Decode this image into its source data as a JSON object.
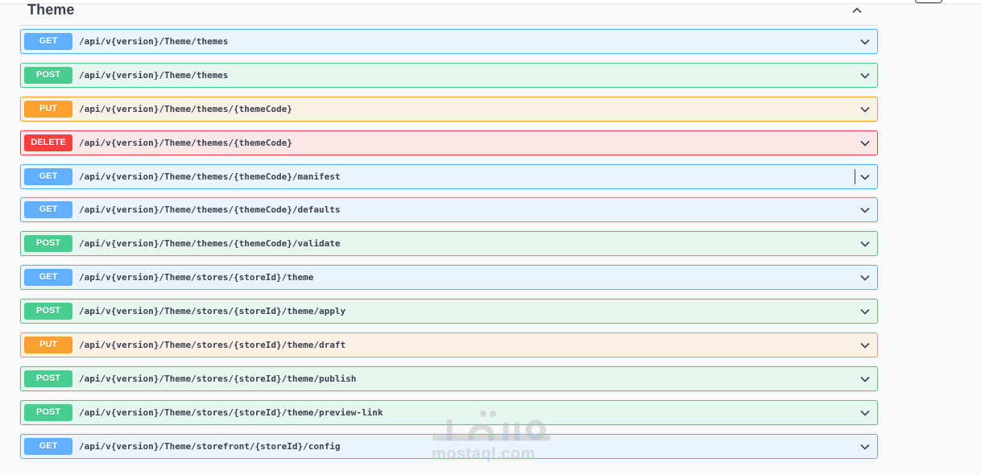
{
  "section": {
    "title": "Theme"
  },
  "operations": [
    {
      "method": "GET",
      "path": "/api/v{version}/Theme/themes"
    },
    {
      "method": "POST",
      "path": "/api/v{version}/Theme/themes"
    },
    {
      "method": "PUT",
      "path": "/api/v{version}/Theme/themes/{themeCode}"
    },
    {
      "method": "DELETE",
      "path": "/api/v{version}/Theme/themes/{themeCode}"
    },
    {
      "method": "GET",
      "path": "/api/v{version}/Theme/themes/{themeCode}/manifest"
    },
    {
      "method": "GET",
      "path": "/api/v{version}/Theme/themes/{themeCode}/defaults"
    },
    {
      "method": "POST",
      "path": "/api/v{version}/Theme/themes/{themeCode}/validate"
    },
    {
      "method": "GET",
      "path": "/api/v{version}/Theme/stores/{storeId}/theme"
    },
    {
      "method": "POST",
      "path": "/api/v{version}/Theme/stores/{storeId}/theme/apply"
    },
    {
      "method": "PUT",
      "path": "/api/v{version}/Theme/stores/{storeId}/theme/draft"
    },
    {
      "method": "POST",
      "path": "/api/v{version}/Theme/stores/{storeId}/theme/publish"
    },
    {
      "method": "POST",
      "path": "/api/v{version}/Theme/stores/{storeId}/theme/preview-link"
    },
    {
      "method": "GET",
      "path": "/api/v{version}/Theme/storefront/{storeId}/config"
    }
  ],
  "watermark": {
    "text": "mostaql.com",
    "icon": "mostaql-logo"
  },
  "colors": {
    "get": "#61affe",
    "post": "#49cc90",
    "put": "#fca130",
    "delete": "#f93e3e",
    "text": "#3b4151"
  }
}
